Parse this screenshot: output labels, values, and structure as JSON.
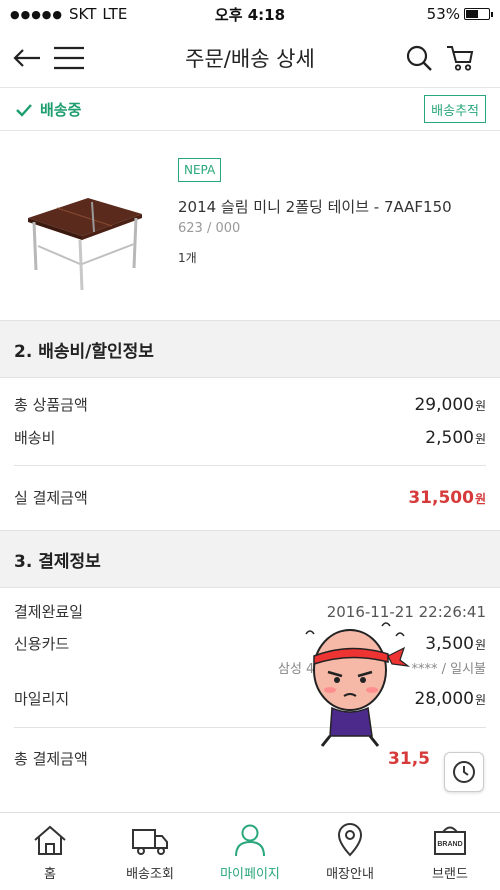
{
  "status_bar": {
    "carrier": "SKT",
    "network": "LTE",
    "time": "오후 4:18",
    "battery": "53%",
    "battery_level": 0.53
  },
  "header": {
    "title": "주문/배송 상세"
  },
  "shipping": {
    "status": "배송중",
    "track_button": "배송추적"
  },
  "product": {
    "brand": "NEPA",
    "name": "2014 슬림 미니 2폴딩 테이브 - 7AAF150",
    "code": "623 / 000",
    "quantity": "1개"
  },
  "section2": {
    "title": "2. 배송비/할인정보",
    "total_label": "총 상품금액",
    "total_value": "29,000",
    "shipping_label": "배송비",
    "shipping_value": "2,500",
    "paid_label": "실 결제금액",
    "paid_value": "31,500",
    "currency": "원"
  },
  "section3": {
    "title": "3. 결제정보",
    "date_label": "결제완료일",
    "date_value": "2016-11-21 22:26:41",
    "card_label": "신용카드",
    "card_value": "3,500",
    "card_detail": "삼성 4",
    "card_detail_2": "**** / 일시불",
    "mileage_label": "마일리지",
    "mileage_value": "28,000",
    "total_label": "총 결제금액",
    "total_value": "31,5",
    "currency": "원"
  },
  "tabs": [
    {
      "label": "홈",
      "icon": "home-icon"
    },
    {
      "label": "배송조회",
      "icon": "truck-icon"
    },
    {
      "label": "마이페이지",
      "icon": "person-icon"
    },
    {
      "label": "매장안내",
      "icon": "location-pin-icon"
    },
    {
      "label": "브랜드",
      "icon": "brand-basket-icon",
      "badge": "BRAND"
    }
  ],
  "colors": {
    "accent": "#2aa77a",
    "price_red": "#d63a3a"
  }
}
